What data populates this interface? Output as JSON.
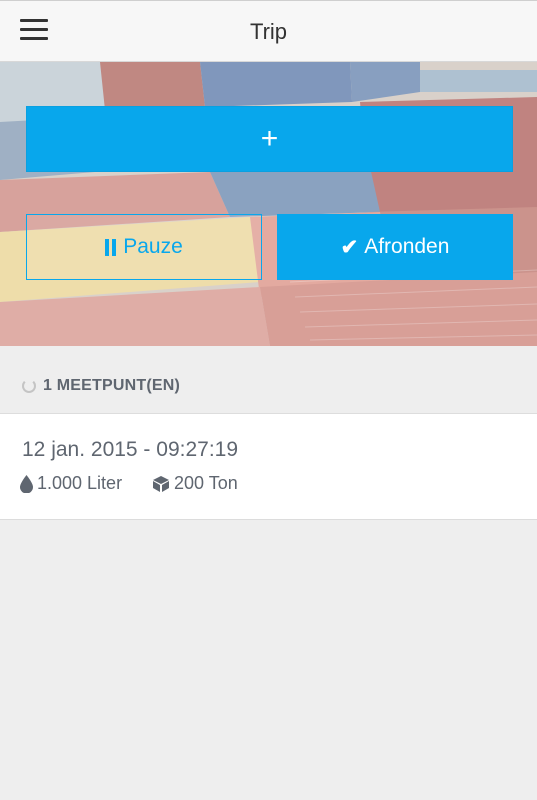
{
  "header": {
    "title": "Trip",
    "menu_icon": "hamburger-menu-icon"
  },
  "actions": {
    "add_label": "+",
    "pause_label": "Pauze",
    "pause_icon": "pause-icon",
    "finish_label": "Afronden",
    "finish_icon": "checkmark-icon",
    "accent_color": "#08a7ec"
  },
  "measurements": {
    "title": "1 MEETPUNT(EN)",
    "title_icon": "refresh-icon",
    "items": [
      {
        "datetime": "12 jan. 2015 - 09:27:19",
        "volume": "1.000 Liter",
        "volume_icon": "water-drop-icon",
        "weight": "200 Ton",
        "weight_icon": "cube-icon"
      }
    ]
  }
}
